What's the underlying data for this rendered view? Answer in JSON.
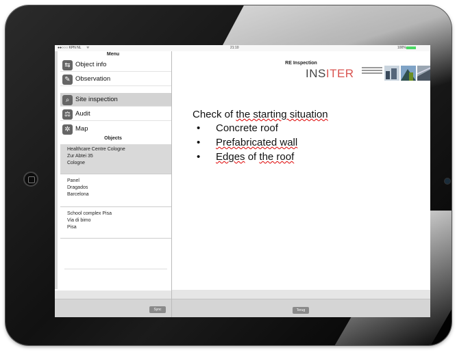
{
  "status": {
    "carrier": "●●○○○ KPN NL",
    "wifi": "ᯤ",
    "time": "21:10",
    "battery": "100%"
  },
  "menu": {
    "title": "Menu",
    "items": [
      {
        "label": "Object info",
        "icon": "object-info-icon",
        "glyph": "⇆"
      },
      {
        "label": "Observation",
        "icon": "pencil-icon",
        "glyph": "✎"
      },
      {
        "label": "Site inspection",
        "icon": "magnifier-icon",
        "glyph": "⌕"
      },
      {
        "label": "Audit",
        "icon": "audit-icon",
        "glyph": "⚖"
      },
      {
        "label": "Map",
        "icon": "map-icon",
        "glyph": "✲"
      }
    ]
  },
  "objects": {
    "title": "Objects",
    "items": [
      {
        "line1": "Healthcare Centre Cologne",
        "line2": "Zur Abtei 35",
        "line3": "Cologne"
      },
      {
        "line1": "Panel",
        "line2": "Dragados",
        "line3": "Barcelona"
      },
      {
        "line1": "School complex Pisa",
        "line2": "Via di bimo",
        "line3": "Pisa"
      }
    ]
  },
  "buttons": {
    "sync": "Sync",
    "back": "Terug"
  },
  "inspection": {
    "title": "RE Inspection",
    "logo": "INSITER",
    "heading_pre": "Check of ",
    "heading_u": "the starting situation",
    "items": [
      {
        "pre": "Concrete roof",
        "u": "",
        "post": ""
      },
      {
        "pre": "",
        "u": "Prefabricated wall",
        "post": ""
      },
      {
        "pre": "",
        "u": "Edges",
        "post": " of "
      },
      {
        "pre": "",
        "u": "the roof",
        "post": ""
      }
    ]
  },
  "colors": {
    "accent": "#d9534f",
    "selected": "#d3d3d3"
  }
}
